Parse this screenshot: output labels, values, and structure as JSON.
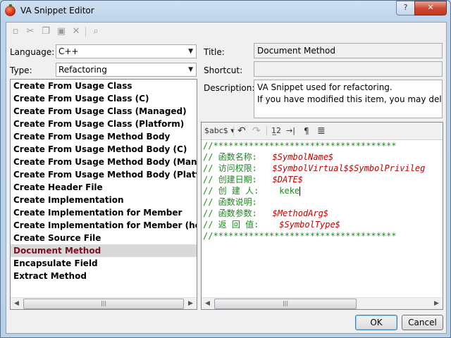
{
  "window": {
    "title": "VA Snippet Editor"
  },
  "toolbar": {
    "icons": [
      "new-icon",
      "cut-icon",
      "copy-icon",
      "paste-icon",
      "delete-icon",
      "find-icon"
    ]
  },
  "form": {
    "language_label": "Language:",
    "language_value": "C++",
    "type_label": "Type:",
    "type_value": "Refactoring",
    "title_label": "Title:",
    "title_value": "Document Method",
    "shortcut_label": "Shortcut:",
    "shortcut_value": "",
    "description_label": "Description:",
    "description_line1": "VA Snippet used for refactoring.",
    "description_line2": "If you have modified this item, you may delet"
  },
  "snippets": {
    "items": [
      "Create From Usage Class",
      "Create From Usage Class (C)",
      "Create From Usage Class (Managed)",
      "Create From Usage Class (Platform)",
      "Create From Usage Method Body",
      "Create From Usage Method Body (C)",
      "Create From Usage Method Body (Managed)",
      "Create From Usage Method Body (Platform)",
      "Create Header File",
      "Create Implementation",
      "Create Implementation for Member",
      "Create Implementation for Member (header)",
      "Create Source File",
      "Document Method",
      "Encapsulate Field",
      "Extract Method"
    ],
    "selected_index": 13
  },
  "editor_toolbar": {
    "reserved_label": "$abc$",
    "undo_glyph": "↶",
    "redo_glyph": "↷",
    "line_numbers_glyph": "1̲2",
    "indent_glyph": "→|",
    "whitespace_glyph": "¶",
    "wrap_glyph": "≣"
  },
  "code": {
    "border_line": "//************************************",
    "lines": [
      {
        "prefix": "// 函数名称:   ",
        "var": "$SymbolName$",
        "suffix": ""
      },
      {
        "prefix": "// 访问权限:   ",
        "var": "$SymbolVirtual$$SymbolPrivileg",
        "suffix": ""
      },
      {
        "prefix": "// 创建日期:   ",
        "var": "$DATE$",
        "suffix": ""
      },
      {
        "prefix": "// 创 建 人:    ",
        "var": "",
        "suffix": "keke"
      },
      {
        "prefix": "// 函数说明:",
        "var": "",
        "suffix": ""
      },
      {
        "prefix": "// 函数参数:   ",
        "var": "$MethodArg$",
        "suffix": ""
      },
      {
        "prefix": "// 返 回 值:    ",
        "var": "$SymbolType$",
        "suffix": ""
      }
    ]
  },
  "buttons": {
    "ok": "OK",
    "cancel": "Cancel"
  },
  "colors": {
    "selected_text": "#7a1020",
    "comment": "#1c8a1c",
    "variable": "#c40000"
  }
}
